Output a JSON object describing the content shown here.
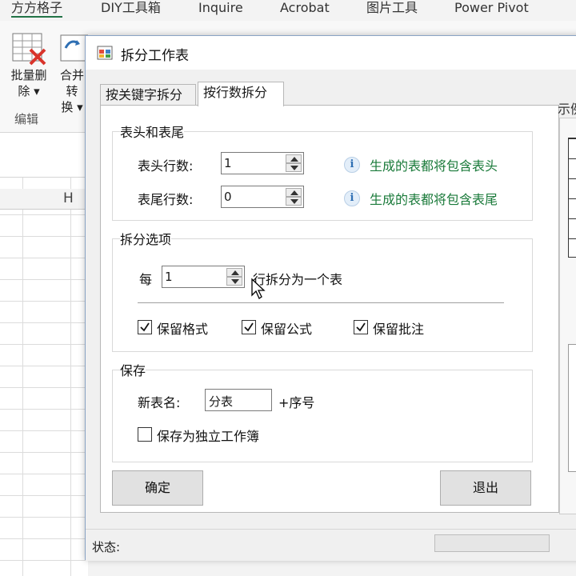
{
  "ribbon": {
    "tabs": [
      "方方格子",
      "DIY工具箱",
      "Inquire",
      "Acrobat",
      "图片工具",
      "Power Pivot"
    ],
    "buttons": [
      {
        "label1": "批量删",
        "label2": "除 ▾"
      },
      {
        "label1": "合并转",
        "label2": "换 ▾"
      }
    ],
    "group_label": "编辑"
  },
  "sheet": {
    "column_header": "H"
  },
  "dialog": {
    "title": "拆分工作表",
    "tabs": [
      "按关键字拆分",
      "按行数拆分"
    ],
    "active_tab_index": 1,
    "header_footer": {
      "title": "表头和表尾",
      "header_rows_label": "表头行数:",
      "header_rows_value": "1",
      "header_info": "生成的表都将包含表头",
      "footer_rows_label": "表尾行数:",
      "footer_rows_value": "0",
      "footer_info": "生成的表都将包含表尾"
    },
    "split_options": {
      "title": "拆分选项",
      "per_label": "每",
      "per_value": "1",
      "suffix": "行拆分为一个表",
      "keep_format": "保留格式",
      "keep_formula": "保留公式",
      "keep_comment": "保留批注",
      "keep_format_checked": true,
      "keep_formula_checked": true,
      "keep_comment_checked": true
    },
    "save": {
      "title": "保存",
      "new_name_label": "新表名:",
      "new_name_value": "分表",
      "new_name_suffix": "+序号",
      "separate_workbook_label": "保存为独立工作簿",
      "separate_workbook_checked": false
    },
    "buttons": {
      "ok": "确定",
      "exit": "退出"
    },
    "status_label": "状态:",
    "side_label": "示例"
  }
}
